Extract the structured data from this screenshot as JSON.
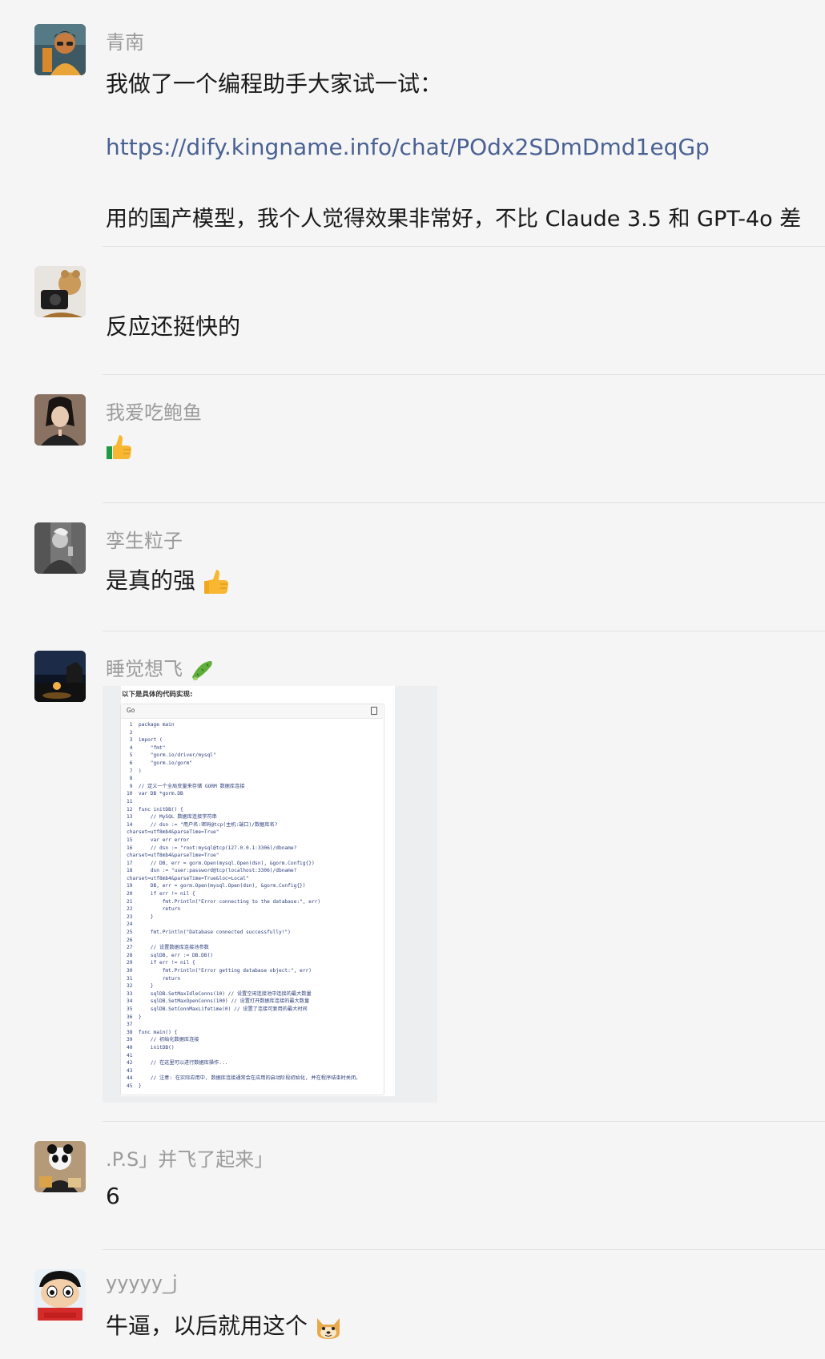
{
  "messages": [
    {
      "name": "青南",
      "line1": "我做了一个编程助手大家试一试：",
      "link": "https://dify.kingname.info/chat/POdx2SDmDmd1eqGp",
      "line3": "用的国产模型，我个人觉得效果非常好，不比 Claude 3.5 和 GPT-4o 差"
    },
    {
      "name": "",
      "text": "反应还挺快的"
    },
    {
      "name": "我爱吃鲍鱼",
      "emoji": "thumbs-up-icon"
    },
    {
      "name": "孪生粒子",
      "text": "是真的强",
      "emoji": "thumbs-up-icon"
    },
    {
      "name": "睡觉想飞",
      "name_emoji": "cucumber-icon"
    },
    {
      "name": ".P.S」并飞了起来」",
      "text": "6"
    },
    {
      "name": "yyyyy_j",
      "text": "牛逼，以后就用这个",
      "emoji": "doge-icon"
    }
  ],
  "code_shot": {
    "caption": "以下是具体的代码实现:",
    "lang": "Go",
    "code": " 1  package main\n 2\n 3  import (\n 4      \"fmt\"\n 5      \"gorm.io/driver/mysql\"\n 6      \"gorm.io/gorm\"\n 7  )\n 8\n 9  // 定义一个全局变量来存储 GORM 数据库连接\n10  var DB *gorm.DB\n11\n12  func initDB() {\n13      // MySQL 数据库连接字符串\n14      // dsn := \"用户名:密码@tcp(主机:端口)/数据库名?\ncharset=utf8mb4&parseTime=True\"\n15      var err error\n16      // dsn := \"root:mysql@tcp(127.0.0.1:3306)/dbname?\ncharset=utf8mb4&parseTime=True\"\n17      // DB, err = gorm.Open(mysql.Open(dsn), &gorm.Config{})\n18      dsn := \"user:password@tcp(localhost:3306)/dbname?\ncharset=utf8mb4&parseTime=True&loc=Local\"\n19      DB, err = gorm.Open(mysql.Open(dsn), &gorm.Config{})\n20      if err != nil {\n21          fmt.Println(\"Error connecting to the database:\", err)\n22          return\n23      }\n24\n25      fmt.Println(\"Database connected successfully!\")\n26\n27      // 设置数据库连接池参数\n28      sqlDB, err := DB.DB()\n29      if err != nil {\n30          fmt.Println(\"Error getting database object:\", err)\n31          return\n32      }\n33      sqlDB.SetMaxIdleConns(10) // 设置空闲连接池中连接的最大数量\n34      sqlDB.SetMaxOpenConns(100) // 设置打开数据库连接的最大数量\n35      sqlDB.SetConnMaxLifetime(0) // 设置了连接可复用的最大时间\n36  }\n37\n38  func main() {\n39      // 初始化数据库连接\n40      initDB()\n41\n42      // 在这里可以进行数据库操作...\n43\n44      // 注意: 在实际应用中, 数据库连接通常会在应用的启动阶段初始化, 并在程序结束时关闭。\n45  }"
  }
}
